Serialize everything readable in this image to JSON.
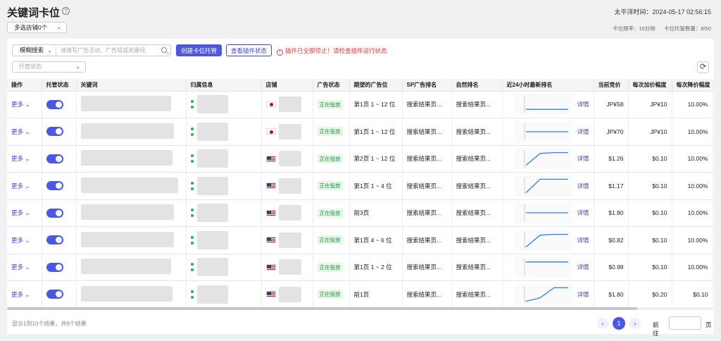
{
  "header": {
    "title": "关键词卡位",
    "timezone_text": "太平洋时间：2024-05-17 02:56:15",
    "store_select": "多选店铺0个",
    "frequency": "卡位频率：15分钟",
    "quota": "卡位托管数量：8/50"
  },
  "toolbar": {
    "search_mode": "模糊搜索",
    "search_placeholder": "请填写广告活动、广告组或关键词",
    "create_button": "创建卡位托管",
    "status_button": "查看插件状态",
    "warning": "插件已全部停止！请检查插件运行状态",
    "hosting_placeholder": "托管状态"
  },
  "table": {
    "columns": [
      "操作",
      "托管状态",
      "关键词",
      "归属信息",
      "店铺",
      "广告状态",
      "期望的广告位",
      "SP广告排名",
      "自然排名",
      "近24小时最新排名",
      "当前竞价",
      "每次加价幅度",
      "每次降价幅度"
    ],
    "rows": [
      {
        "op": "更多",
        "flag": "jp",
        "status": "正在投放",
        "target": "第1页 1 ~ 12 位",
        "sp": "搜索结果页...",
        "natural": "搜索结果页...",
        "detail": "详情",
        "bid": "JP¥58",
        "inc": "JP¥10",
        "dec": "10.00%",
        "trend": [
          0.2,
          0.2,
          0.2,
          0.2
        ]
      },
      {
        "op": "更多",
        "flag": "jp",
        "status": "正在投放",
        "target": "第1页 1 ~ 12 位",
        "sp": "搜索结果页...",
        "natural": "搜索结果页...",
        "detail": "详情",
        "bid": "JP¥70",
        "inc": "JP¥10",
        "dec": "10.00%",
        "trend": [
          0.5,
          0.5
        ]
      },
      {
        "op": "更多",
        "flag": "us",
        "status": "正在投放",
        "target": "第2页 1 ~ 12 位",
        "sp": "搜索结果页...",
        "natural": "搜索结果页...",
        "detail": "详情",
        "bid": "$1.26",
        "inc": "$0.10",
        "dec": "10.00%",
        "trend": [
          0.1,
          0.8,
          0.85,
          0.85
        ]
      },
      {
        "op": "更多",
        "flag": "us",
        "status": "正在投放",
        "target": "第1页 1 ~ 4 位",
        "sp": "搜索结果页...",
        "natural": "搜索结果页...",
        "detail": "详情",
        "bid": "$1.17",
        "inc": "$0.10",
        "dec": "10.00%",
        "trend": [
          0.1,
          0.9,
          0.9,
          0.9
        ]
      },
      {
        "op": "更多",
        "flag": "us",
        "status": "正在投放",
        "target": "前3页",
        "sp": "搜索结果页...",
        "natural": "搜索结果页...",
        "detail": "详情",
        "bid": "$1.80",
        "inc": "$0.10",
        "dec": "10.00%",
        "trend": [
          0.5,
          0.5
        ]
      },
      {
        "op": "更多",
        "flag": "us",
        "status": "正在投放",
        "target": "第1页 4 ~ 6 位",
        "sp": "搜索结果页...",
        "natural": "搜索结果页...",
        "detail": "详情",
        "bid": "$0.82",
        "inc": "$0.10",
        "dec": "10.00%",
        "trend": [
          0.1,
          0.8,
          0.85,
          0.85
        ]
      },
      {
        "op": "更多",
        "flag": "us",
        "status": "正在投放",
        "target": "第1页 1 ~ 2 位",
        "sp": "搜索结果页...",
        "natural": "搜索结果页...",
        "detail": "详情",
        "bid": "$0.98",
        "inc": "$0.10",
        "dec": "10.00%",
        "trend": [
          0.8,
          0.8
        ]
      },
      {
        "op": "更多",
        "flag": "us",
        "status": "正在投放",
        "target": "前1页",
        "sp": "搜索结果页...",
        "natural": "搜索结果页...",
        "detail": "详情",
        "bid": "$1.80",
        "inc": "$0.20",
        "dec": "$0.10",
        "trend": [
          0.1,
          0.3,
          0.9,
          0.9
        ]
      }
    ]
  },
  "footer": {
    "summary": "显示1到10个结果，共8个结果",
    "current_page": "1",
    "goto_label": "前往",
    "page_unit": "页"
  }
}
